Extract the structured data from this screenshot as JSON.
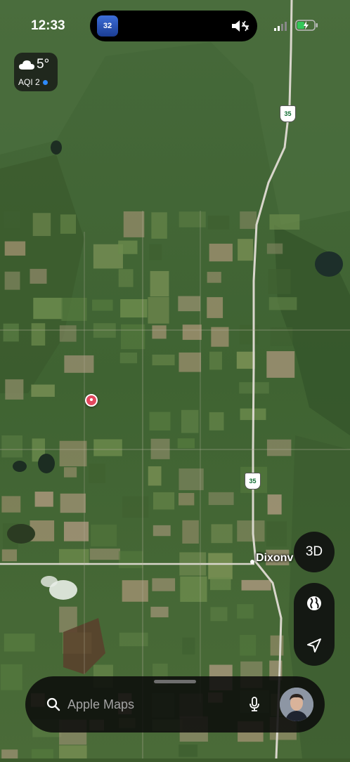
{
  "status_bar": {
    "time": "12:33",
    "live_activity_app_label": "32"
  },
  "weather": {
    "temperature": "5°",
    "aqi": "AQI 2",
    "icon": "cloud-icon"
  },
  "map": {
    "type": "satellite",
    "road_shield_label": "35",
    "place_label": "Dixonv",
    "pin_color": "#e2485f"
  },
  "controls": {
    "view_3d_label": "3D",
    "globe_icon": "globe-icon",
    "location_icon": "location-arrow-icon"
  },
  "search": {
    "placeholder": "Apple Maps"
  }
}
